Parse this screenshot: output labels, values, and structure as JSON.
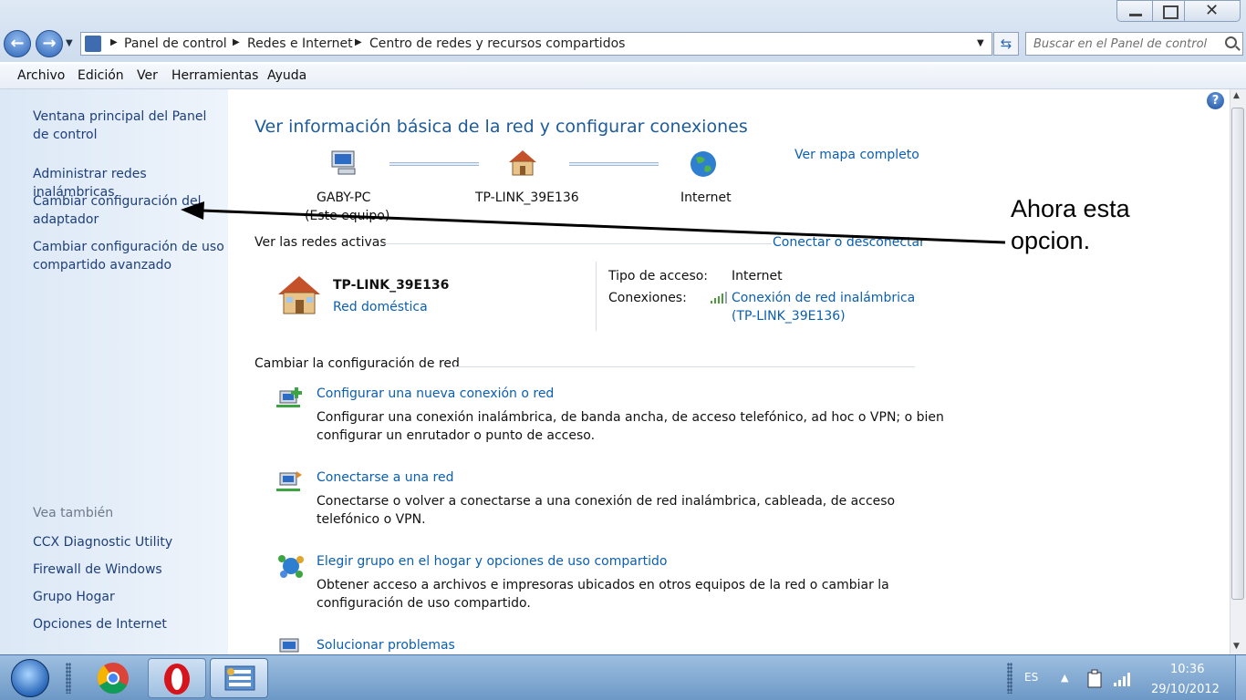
{
  "window": {
    "close_glyph": "✕"
  },
  "nav": {
    "back_glyph": "←",
    "forward_glyph": "→",
    "dropdown_glyph": "▼"
  },
  "address": {
    "crumbs": [
      "Panel de control",
      "Redes e Internet",
      "Centro de redes y recursos compartidos"
    ],
    "separator": "▶",
    "dropdown_glyph": "▼",
    "refresh_glyph": "⇆"
  },
  "search": {
    "placeholder": "Buscar en el Panel de control"
  },
  "menubar": {
    "items": [
      "Archivo",
      "Edición",
      "Ver",
      "Herramientas",
      "Ayuda"
    ]
  },
  "sidebar": {
    "links": [
      "Ventana principal del Panel de control",
      "Administrar redes inalámbricas",
      "Cambiar configuración del adaptador",
      "Cambiar configuración de uso compartido avanzado"
    ],
    "see_also_title": "Vea también",
    "see_also": [
      "CCX Diagnostic Utility",
      "Firewall de Windows",
      "Grupo Hogar",
      "Opciones de Internet"
    ]
  },
  "main": {
    "help_glyph": "?",
    "heading": "Ver información básica de la red y configurar conexiones",
    "map_link": "Ver mapa completo",
    "map_nodes": [
      {
        "name": "GABY-PC",
        "sub": "(Este equipo)",
        "icon": "computer-icon"
      },
      {
        "name": "TP-LINK_39E136",
        "icon": "house-icon"
      },
      {
        "name": "Internet",
        "icon": "globe-icon"
      }
    ],
    "active_networks": {
      "title": "Ver las redes activas",
      "connect_link": "Conectar o desconectar",
      "network_name": "TP-LINK_39E136",
      "network_type": "Red doméstica",
      "access_label": "Tipo de acceso:",
      "access_value": "Internet",
      "connections_label": "Conexiones:",
      "connection_link_1": "Conexión de red inalámbrica",
      "connection_link_2": "(TP-LINK_39E136)"
    },
    "change_settings": {
      "title": "Cambiar la configuración de red",
      "tasks": [
        {
          "title": "Configurar una nueva conexión o red",
          "desc_1": "Configurar una conexión inalámbrica, de banda ancha, de acceso telefónico, ad hoc o VPN; o bien",
          "desc_2": "configurar un enrutador o punto de acceso."
        },
        {
          "title": "Conectarse a una red",
          "desc_1": "Conectarse o volver a conectarse a una conexión de red inalámbrica, cableada, de acceso",
          "desc_2": "telefónico o VPN."
        },
        {
          "title": "Elegir grupo en el hogar y opciones de uso compartido",
          "desc_1": "Obtener acceso a archivos e impresoras ubicados en otros equipos de la red o cambiar la",
          "desc_2": "configuración de uso compartido."
        },
        {
          "title": "Solucionar problemas"
        }
      ]
    }
  },
  "annotation": {
    "line_1": "Ahora esta",
    "line_2": "opcion."
  },
  "scrollbar": {
    "up_glyph": "▲",
    "down_glyph": "▼"
  },
  "taskbar": {
    "tray_language": "ES",
    "tray_arrow": "▲",
    "time": "10:36",
    "date": "29/10/2012"
  },
  "colors": {
    "link": "#0b5fb0",
    "heading": "#1d5b9a",
    "sidebar_link": "#1e3f7a"
  }
}
